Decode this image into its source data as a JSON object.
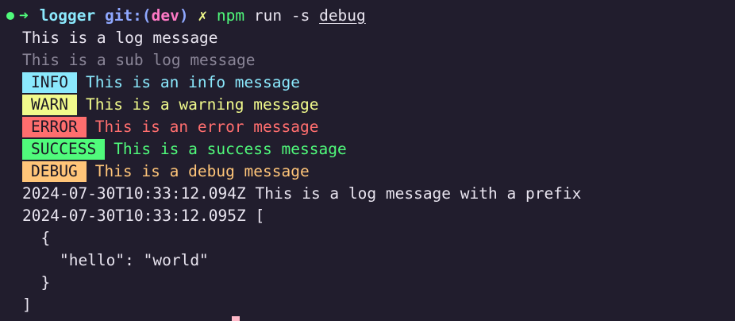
{
  "prompt": {
    "dir": "logger",
    "git_label": "git:(",
    "branch": "dev",
    "git_close": ")",
    "dirty": "✗",
    "cmd": "npm",
    "args": "run -s",
    "script": "debug"
  },
  "lines": {
    "log": "This is a log message",
    "sub_log": "This is a sub log message",
    "info": {
      "badge": "INFO",
      "text": "This is an info message"
    },
    "warn": {
      "badge": "WARN",
      "text": "This is a warning message"
    },
    "error": {
      "badge": "ERROR",
      "text": "This is an error message"
    },
    "success": {
      "badge": "SUCCESS",
      "text": "This is a success message"
    },
    "debug": {
      "badge": "DEBUG",
      "text": "This is a debug message"
    },
    "prefixed": "2024-07-30T10:33:12.094Z This is a log message with a prefix",
    "json_head": "2024-07-30T10:33:12.095Z [",
    "json_open": "  {",
    "json_body": "    \"hello\": \"world\"",
    "json_close": "  }",
    "json_end": "]"
  },
  "colors": {
    "background": "#211d2d",
    "info": "#8be9fd",
    "warn": "#f1fa8c",
    "error": "#ff6e6e",
    "success": "#50fa7b",
    "debug": "#ffc579"
  }
}
